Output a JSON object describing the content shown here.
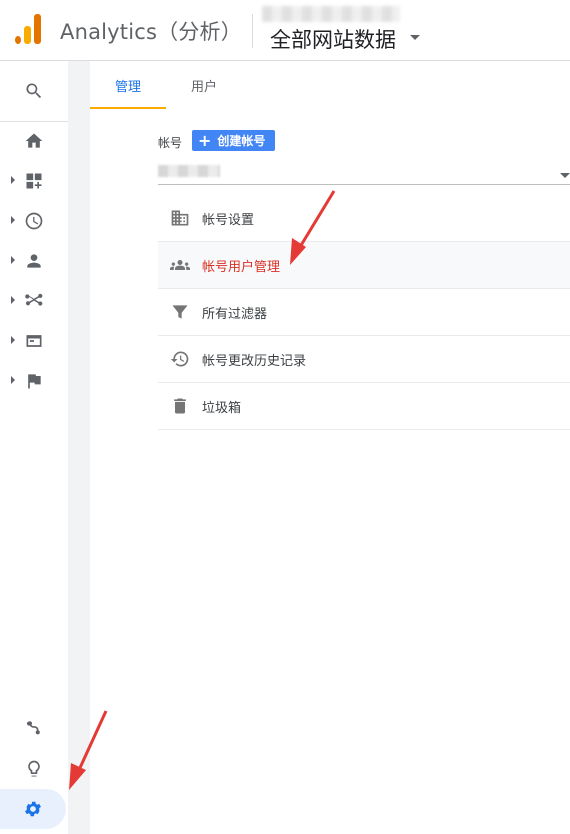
{
  "header": {
    "app_title": "Analytics（分析）",
    "property_name": "全部网站数据"
  },
  "sidebar": {
    "items": [
      {
        "icon": "search-icon"
      },
      {
        "icon": "home-icon"
      },
      {
        "icon": "customization-icon"
      },
      {
        "icon": "realtime-icon"
      },
      {
        "icon": "audience-icon"
      },
      {
        "icon": "acquisition-icon"
      },
      {
        "icon": "behavior-icon"
      },
      {
        "icon": "conversions-icon"
      },
      {
        "icon": "attribution-icon"
      },
      {
        "icon": "discover-icon"
      },
      {
        "icon": "admin-gear-icon"
      }
    ]
  },
  "tabs": [
    {
      "label": "管理",
      "active": true
    },
    {
      "label": "用户",
      "active": false
    }
  ],
  "account": {
    "label": "帐号",
    "create_button": "创建帐号"
  },
  "menu": {
    "items": [
      {
        "label": "帐号设置",
        "icon": "building-icon"
      },
      {
        "label": "帐号用户管理",
        "icon": "users-icon",
        "highlighted": true
      },
      {
        "label": "所有过滤器",
        "icon": "filter-icon"
      },
      {
        "label": "帐号更改历史记录",
        "icon": "history-icon"
      },
      {
        "label": "垃圾箱",
        "icon": "trash-icon"
      }
    ]
  },
  "colors": {
    "accent_blue": "#1a73e8",
    "tab_indicator": "#f9ab00",
    "highlight_text": "#d93025",
    "button_blue": "#4285f4",
    "annotation_red": "#e53935"
  }
}
